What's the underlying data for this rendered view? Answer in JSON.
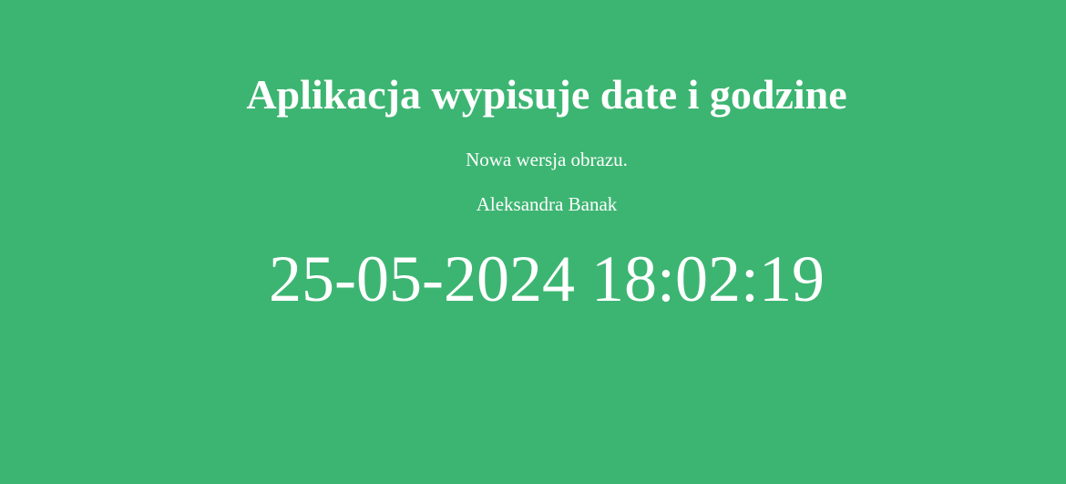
{
  "page": {
    "title": "Aplikacja wypisuje date i godzine",
    "subtitle": "Nowa wersja obrazu.",
    "author": "Aleksandra Banak",
    "datetime": "25-05-2024 18:02:19"
  },
  "colors": {
    "background": "#3db572",
    "text": "#ffffff"
  }
}
